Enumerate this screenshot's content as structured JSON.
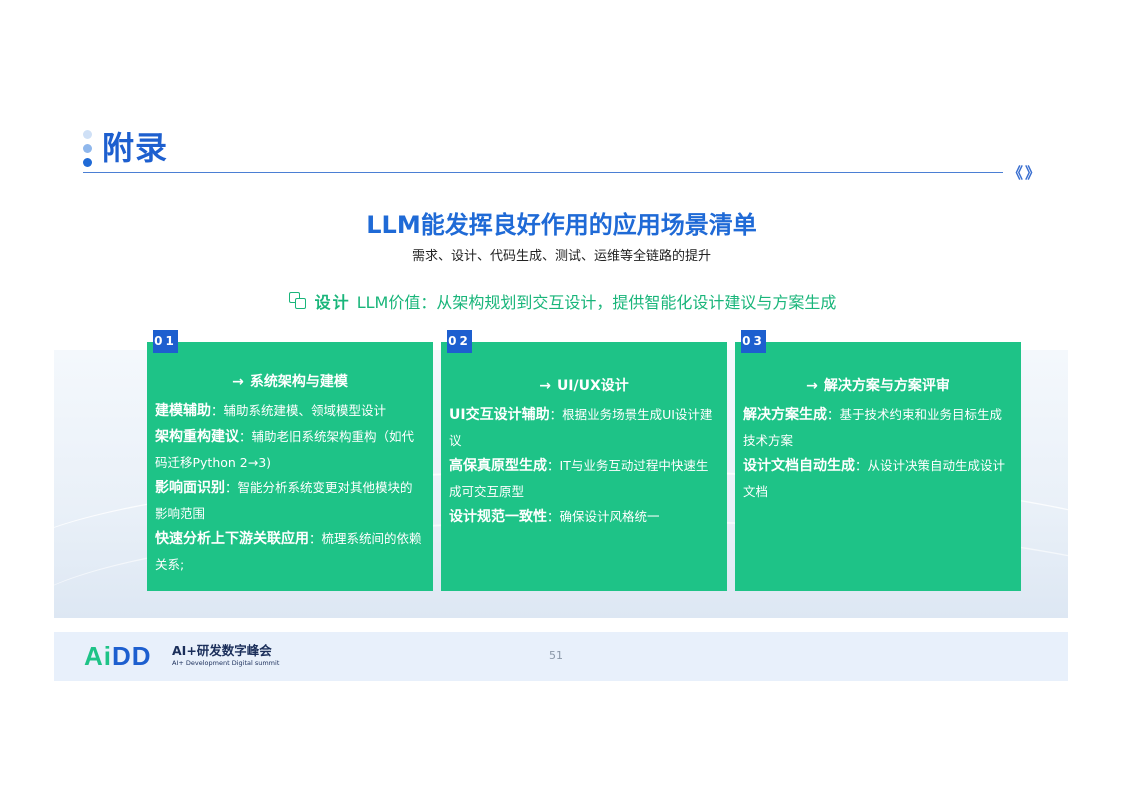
{
  "header": {
    "title": "附录",
    "chevron_left": "《",
    "chevron_right": "》"
  },
  "main_title": "LLM能发挥良好作用的应用场景清单",
  "subtitle": "需求、设计、代码生成、测试、运维等全链路的提升",
  "value_line": {
    "icon": "copy-design-icon",
    "key": "设计",
    "text": "LLM价值：从架构规划到交互设计，提供智能化设计建议与方案生成"
  },
  "cards": [
    {
      "badge": "01",
      "arrow": "→",
      "heading": "系统架构与建模",
      "items": [
        {
          "key": "建模辅助",
          "sep": "：",
          "text": "辅助系统建模、领域模型设计"
        },
        {
          "key": "架构重构建议",
          "sep": "：",
          "text": "辅助老旧系统架构重构（如代码迁移Python 2→3)"
        },
        {
          "key": "影响面识别",
          "sep": "：",
          "text": "智能分析系统变更对其他模块的影响范围"
        },
        {
          "key": "快速分析上下游关联应用",
          "sep": "：",
          "text": "梳理系统间的依赖关系;"
        }
      ]
    },
    {
      "badge": "02",
      "arrow": "→",
      "heading": "UI/UX设计",
      "items": [
        {
          "key": "UI交互设计辅助",
          "sep": "：",
          "text": "根据业务场景生成UI设计建议"
        },
        {
          "key": "高保真原型生成",
          "sep": "：",
          "text": "IT与业务互动过程中快速生成可交互原型"
        },
        {
          "key": "设计规范一致性",
          "sep": "：",
          "text": "确保设计风格统一"
        }
      ]
    },
    {
      "badge": "03",
      "arrow": "→",
      "heading": "解决方案与方案评审",
      "items": [
        {
          "key": "解决方案生成",
          "sep": "：",
          "text": "基于技术约束和业务目标生成技术方案"
        },
        {
          "key": "设计文档自动生成",
          "sep": "：",
          "text": "从设计决策自动生成设计文档"
        }
      ]
    }
  ],
  "footer": {
    "logo_mark_a": "Ai",
    "logo_mark_dd": "DD",
    "logo_name": "AI+研发数字峰会",
    "logo_sub": "AI+ Development Digital summit",
    "page_number": "51"
  },
  "colors": {
    "brand_blue": "#1d5fcf",
    "accent_green": "#1ec387"
  }
}
